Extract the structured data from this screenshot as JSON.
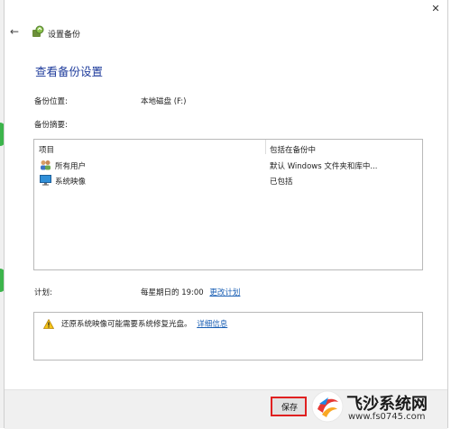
{
  "window": {
    "title": "设置备份",
    "close_glyph": "✕",
    "back_glyph": "←"
  },
  "page": {
    "heading": "查看备份设置",
    "location_label": "备份位置:",
    "location_value": "本地磁盘 (F:)",
    "summary_label": "备份摘要:"
  },
  "summary_table": {
    "headers": [
      "项目",
      "包括在备份中"
    ],
    "rows": [
      {
        "icon": "users-icon",
        "item": "所有用户",
        "included": "默认 Windows 文件夹和库中..."
      },
      {
        "icon": "system-image-icon",
        "item": "系统映像",
        "included": "已包括"
      }
    ]
  },
  "schedule": {
    "label": "计划:",
    "value": "每星期日的 19:00",
    "change_link": "更改计划"
  },
  "warning": {
    "icon": "warning-icon",
    "text": "还原系统映像可能需要系统修复光盘。",
    "details_link": "详细信息"
  },
  "footer": {
    "save_label": "保存"
  },
  "watermark": {
    "brand": "飞沙系统网",
    "url": "www.fs0745.com"
  },
  "colors": {
    "heading": "#1f3c9c",
    "link": "#1a5fb4",
    "highlight": "#e02020",
    "side_markers": "#3cb44b"
  }
}
